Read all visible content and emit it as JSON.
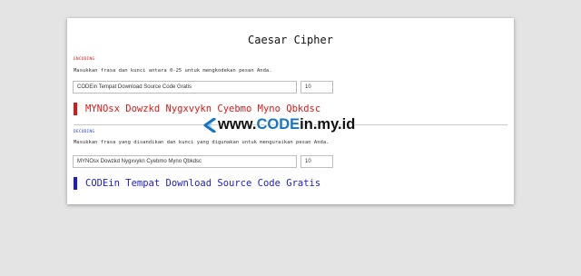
{
  "app": {
    "title": "Caesar Cipher"
  },
  "encoding": {
    "label": "ENCODING",
    "description": "Masukkan frasa dan kunci antara 0-25 untuk mengkodekan pesan Anda.",
    "text_value": "CODEin Tempat Download Source Code Gratis",
    "key_value": "10",
    "result": "MYNOsx Dowzkd Nygxvykn Cyebmo Myno Qbkdsc",
    "accent_color": "#e01515"
  },
  "decoding": {
    "label": "DECODING",
    "description": "Masukkan frasa yang disandikan dan kunci yang digunakan untuk menguraikan pesan Anda.",
    "text_value": "MYNOsx Dowzkd Nygxvykn Cyebmo Myno Qbkdsc",
    "key_value": "10",
    "result": "CODEin Tempat Download Source Code Gratis",
    "accent_color": "#1a1adf"
  },
  "watermark": {
    "prefix": "www.",
    "brand": "CODE",
    "suffix": "in.my.id",
    "icon": "chevron-left-icon"
  }
}
